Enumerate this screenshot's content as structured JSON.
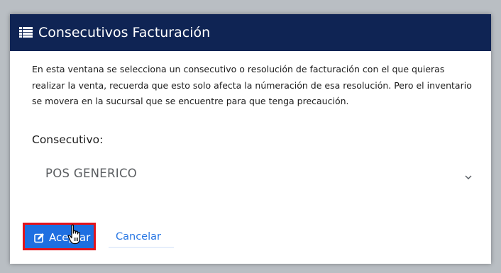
{
  "modal": {
    "title": "Consecutivos Facturación",
    "title_icon": "list-icon",
    "description": "En esta ventana se selecciona un consecutivo o resolución de facturación con el que quieras realizar la venta, recuerda que esto solo afecta la númeración de esa resolución. Pero el inventario se movera en la sucursal que se encuentre para que tenga precaución.",
    "field_label": "Consecutivo:",
    "selected_option": "POS GENERICO",
    "accept_label": "Aceptar",
    "accept_icon": "edit-icon",
    "cancel_label": "Cancelar"
  },
  "colors": {
    "header_bg": "#0f2454",
    "primary": "#1e6fe1",
    "highlight_border": "#e3141b",
    "link": "#2a78e4"
  }
}
